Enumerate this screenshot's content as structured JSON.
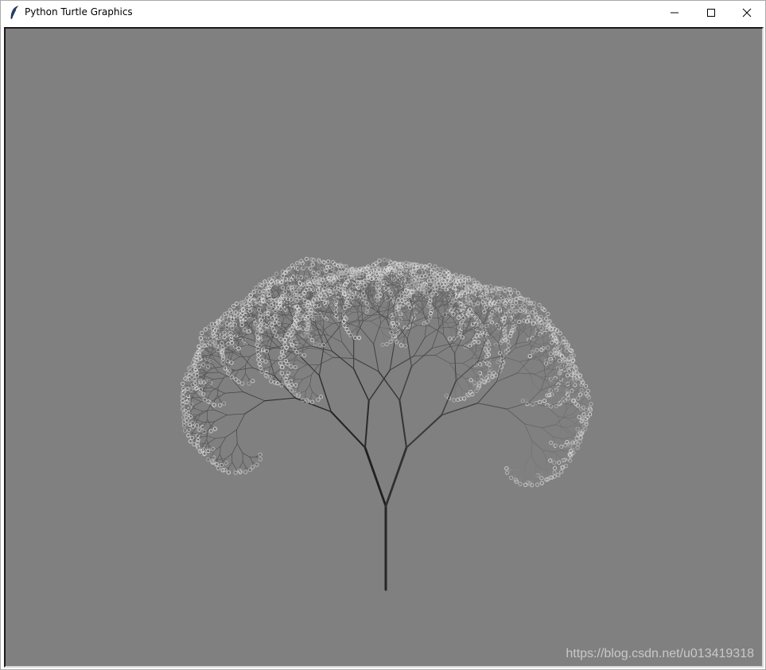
{
  "window": {
    "title": "Python Turtle Graphics",
    "app_icon": "feather-icon",
    "controls": {
      "minimize_icon": "minimize-icon",
      "maximize_icon": "maximize-icon",
      "close_icon": "close-icon"
    }
  },
  "canvas": {
    "background_color": "#808080",
    "drawing": "fractal-tree",
    "trunk_color": "#262626",
    "leaf_color": "#c0c0c0"
  },
  "watermark": {
    "text": "https://blog.csdn.net/u013419318"
  }
}
